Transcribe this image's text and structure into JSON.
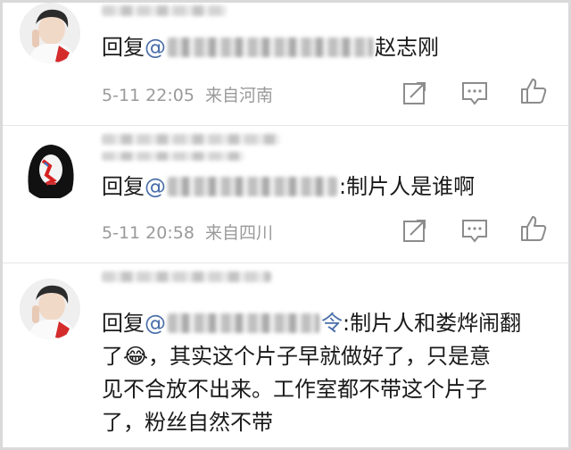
{
  "comments": [
    {
      "reply_prefix": "回复",
      "mention_suffix": "赵志刚",
      "text": "",
      "date": "5-11 22:05",
      "location": "来自河南"
    },
    {
      "reply_prefix": "回复",
      "mention_suffix": "",
      "text": ":制片人是谁啊",
      "date": "5-11 20:58",
      "location": "来自四川"
    },
    {
      "reply_prefix": "回复",
      "mention_suffix": "令",
      "line1": ":制片人和娄烨闹翻",
      "line2a": "了",
      "emoji": "😂",
      "line2b": "，其实这个片子早就做好了，只是意",
      "line3": "见不合放不出来。工作室都不带这个片子",
      "line4": "了，粉丝自然不带"
    }
  ],
  "icons": {
    "share": "share-icon",
    "reply": "comment-icon",
    "like": "thumbs-up-icon"
  }
}
